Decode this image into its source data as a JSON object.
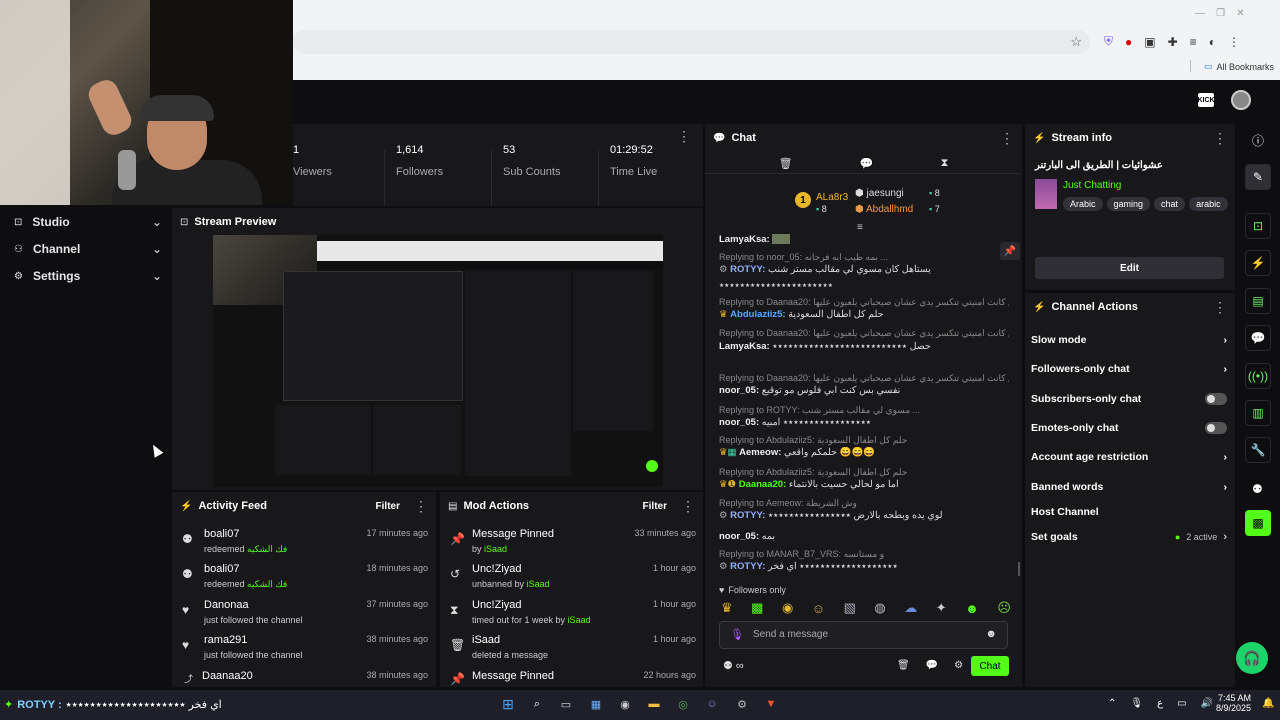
{
  "browser": {
    "bookmarks_label": "All Bookmarks"
  },
  "sidebar": {
    "items": [
      {
        "label": "Studio"
      },
      {
        "label": "Channel"
      },
      {
        "label": "Settings"
      }
    ]
  },
  "stats": [
    {
      "value": "1",
      "label": "Viewers"
    },
    {
      "value": "1,614",
      "label": "Followers"
    },
    {
      "value": "53",
      "label": "Sub Counts"
    },
    {
      "value": "01:29:52",
      "label": "Time Live"
    }
  ],
  "stream_preview": {
    "title": "Stream Preview"
  },
  "activity_feed": {
    "title": "Activity Feed",
    "filter_label": "Filter",
    "items": [
      {
        "user": "boali07",
        "action": "redeemed",
        "reward": "فك الشكيه",
        "time": "17 minutes ago"
      },
      {
        "user": "boali07",
        "action": "redeemed",
        "reward": "فك الشكيه",
        "time": "18 minutes ago"
      },
      {
        "user": "Danonaa",
        "action": "just followed the channel",
        "reward": "",
        "time": "37 minutes ago"
      },
      {
        "user": "rama291",
        "action": "just followed the channel",
        "reward": "",
        "time": "38 minutes ago"
      },
      {
        "user": "Daanaa20",
        "action": "",
        "reward": "",
        "time": "38 minutes ago"
      }
    ]
  },
  "mod_actions": {
    "title": "Mod Actions",
    "filter_label": "Filter",
    "items": [
      {
        "title": "Message Pinned",
        "prefix": "by",
        "mod": "iSaad",
        "time": "33 minutes ago"
      },
      {
        "title": "Unc!Ziyad",
        "prefix": "unbanned by",
        "mod": "iSaad",
        "time": "1 hour ago"
      },
      {
        "title": "Unc!Ziyad",
        "prefix": "timed out for 1 week by",
        "mod": "iSaad",
        "time": "1 hour ago"
      },
      {
        "title": "iSaad",
        "prefix": "deleted a message",
        "mod": "",
        "time": "1 hour ago"
      },
      {
        "title": "Message Pinned",
        "prefix": "",
        "mod": "",
        "time": "22 hours ago"
      }
    ]
  },
  "chat": {
    "title": "Chat",
    "top_users": [
      {
        "name": "ALa8r3",
        "count": "8"
      },
      {
        "name": "jaesungi",
        "count": "8"
      },
      {
        "name": "Abdallhmd",
        "count": "7"
      }
    ],
    "messages": [
      {
        "reply": "",
        "user": "LamyaKsa:",
        "text": ""
      },
      {
        "reply": "Replying to noor_05: بمه طيب ابه فرحانه ...",
        "user": "ROTYY:",
        "text": "يستاهل كان مسوي لي مقالب مستر شنب"
      },
      {
        "reply": "",
        "user": "",
        "text": "٭٭٭٭٭٭٭٭٭٭٭٭٭٭٭٭٭٭٭٭٭٭"
      },
      {
        "reply": "Replying to Daanaa20: استغفر الله بس كانت امنيتي تتكسر يدي عشان صيحباتي يلعبون عليها",
        "user": "Abdulaziiz5:",
        "text": "حلم كل اطفال السعودية"
      },
      {
        "reply": "Replying to Daanaa20: استغفر الله بس كانت امنيتي تتكسر يدي عشان صيحباتي يلعبون عليها",
        "user": "LamyaKsa:",
        "text": "حصل ٭٭٭٭٭٭٭٭٭٭٭٭٭٭٭٭٭٭٭٭٭٭٭٭٭٭"
      },
      {
        "reply": "Replying to Daanaa20: استغفر الله بس كانت امنيتي تتكسر يدي عشان صيحباتي يلعبون عليها",
        "user": "noor_05:",
        "text": "نفسي بس كنت ابي فلوس مو توقيع"
      },
      {
        "reply": "Replying to ROTYY: مسوي لي مقالب مستر شنب ...",
        "user": "noor_05:",
        "text": "٭٭٭٭٭٭٭٭٭٭٭٭٭٭٭٭٭ امبيه"
      },
      {
        "reply": "Replying to Abdulaziiz5: حلم كل اطفال السعودية",
        "user": "Aemeow:",
        "text": "حلمكم واقعي"
      },
      {
        "reply": "Replying to Abdulaziiz5: حلم كل اطفال السعودية",
        "user": "Daanaa20:",
        "text": "اما مو لحالي حسيت بالانتماء"
      },
      {
        "reply": "Replying to Aemeow: وش الشريطة",
        "user": "ROTYY:",
        "text": "لوي يده وبطحه بالارض ٭٭٭٭٭٭٭٭٭٭٭٭٭٭٭٭"
      },
      {
        "reply": "",
        "user": "noor_05:",
        "text": "بمه"
      },
      {
        "reply": "Replying to MANAR_B7_VRS: و مستانسه",
        "user": "ROTYY:",
        "text": "٭٭٭٭٭٭٭٭٭٭٭٭٭٭٭٭٭٭٭ اي فخر"
      }
    ],
    "followers_only_label": "Followers only",
    "input_placeholder": "Send a message",
    "send_label": "Chat"
  },
  "stream_info": {
    "title": "Stream info",
    "stream_title": "عشوائيات | الطريق الى البارتنر",
    "category": "Just Chatting",
    "tags": [
      "Arabic",
      "gaming",
      "chat",
      "arabic"
    ],
    "edit_label": "Edit"
  },
  "channel_actions": {
    "title": "Channel Actions",
    "items": [
      {
        "label": "Slow mode",
        "control": "chevron"
      },
      {
        "label": "Followers-only chat",
        "control": "chevron"
      },
      {
        "label": "Subscribers-only chat",
        "control": "toggle"
      },
      {
        "label": "Emotes-only chat",
        "control": "toggle"
      },
      {
        "label": "Account age restriction",
        "control": "chevron"
      },
      {
        "label": "Banned words",
        "control": "chevron"
      },
      {
        "label": "Host Channel",
        "control": "none"
      },
      {
        "label": "Set goals",
        "control": "chevron"
      }
    ],
    "goals_status": "2 active"
  },
  "taskbar": {
    "ticker_user": "ROTYY :",
    "ticker_text": "اي فخر ٭٭٭٭٭٭٭٭٭٭٭٭٭٭٭٭٭٭٭٭",
    "lang": "ع",
    "time": "7:45 AM",
    "date": "8/9/2025"
  },
  "colors": {
    "accent": "#53fc18",
    "panel": "#18181b",
    "bg": "#0e0e10"
  }
}
